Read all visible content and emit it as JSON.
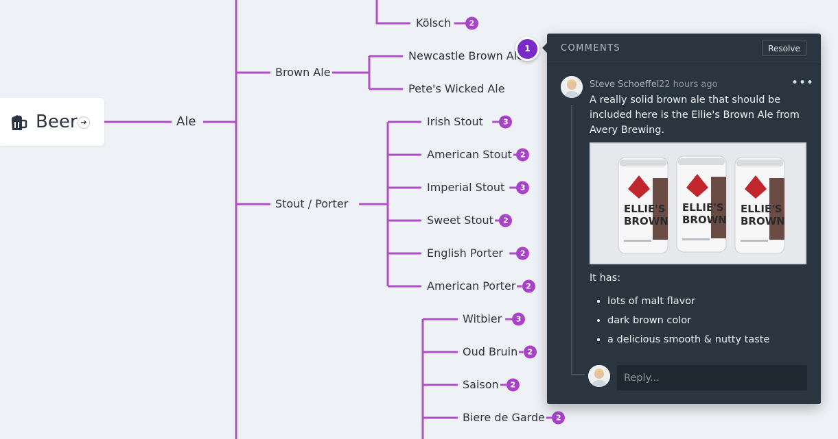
{
  "tree": {
    "root": "Beer",
    "category": "Ale",
    "groups": [
      {
        "label": "Brown Ale",
        "children": [
          {
            "label": "Newcastle Brown Ale",
            "count": ""
          },
          {
            "label": "Pete's Wicked Ale",
            "count": ""
          }
        ]
      },
      {
        "label": "Stout / Porter",
        "children": [
          {
            "label": "Irish Stout",
            "count": "3"
          },
          {
            "label": "American Stout",
            "count": "2"
          },
          {
            "label": "Imperial Stout",
            "count": "3"
          },
          {
            "label": "Sweet Stout",
            "count": "2"
          },
          {
            "label": "English Porter",
            "count": "2"
          },
          {
            "label": "American Porter",
            "count": "2"
          }
        ]
      }
    ],
    "top_leaf": {
      "label": "Kölsch",
      "count": "2"
    },
    "lower_leaves": [
      {
        "label": "Witbier",
        "count": "3"
      },
      {
        "label": "Oud Bruin",
        "count": "2"
      },
      {
        "label": "Saison",
        "count": "2"
      },
      {
        "label": "Biere de Garde",
        "count": "2"
      }
    ],
    "line_color": "#b04fc8",
    "badge_color": "#a843c9"
  },
  "marker": {
    "number": "1",
    "color": "#7a2ac8"
  },
  "comments": {
    "title": "COMMENTS",
    "resolve_label": "Resolve",
    "comment": {
      "author": "Steve Schoeffel",
      "time": "22 hours ago",
      "text": "A really solid brown ale that should be included here is the Ellie's Brown Ale from Avery Brewing.",
      "image_can_text": {
        "line1": "ELLIE'S",
        "line2": "BROWN"
      },
      "it_has": "It has:",
      "bullets": [
        "lots of malt flavor",
        "dark brown color",
        "a delicious smooth & nutty taste"
      ]
    },
    "reply_placeholder": "Reply...",
    "panel_color": "#2b3540"
  },
  "icons": {
    "root": "beer-mug-icon",
    "root_link": "arrow-right-icon",
    "more": "more-horizontal-icon"
  }
}
